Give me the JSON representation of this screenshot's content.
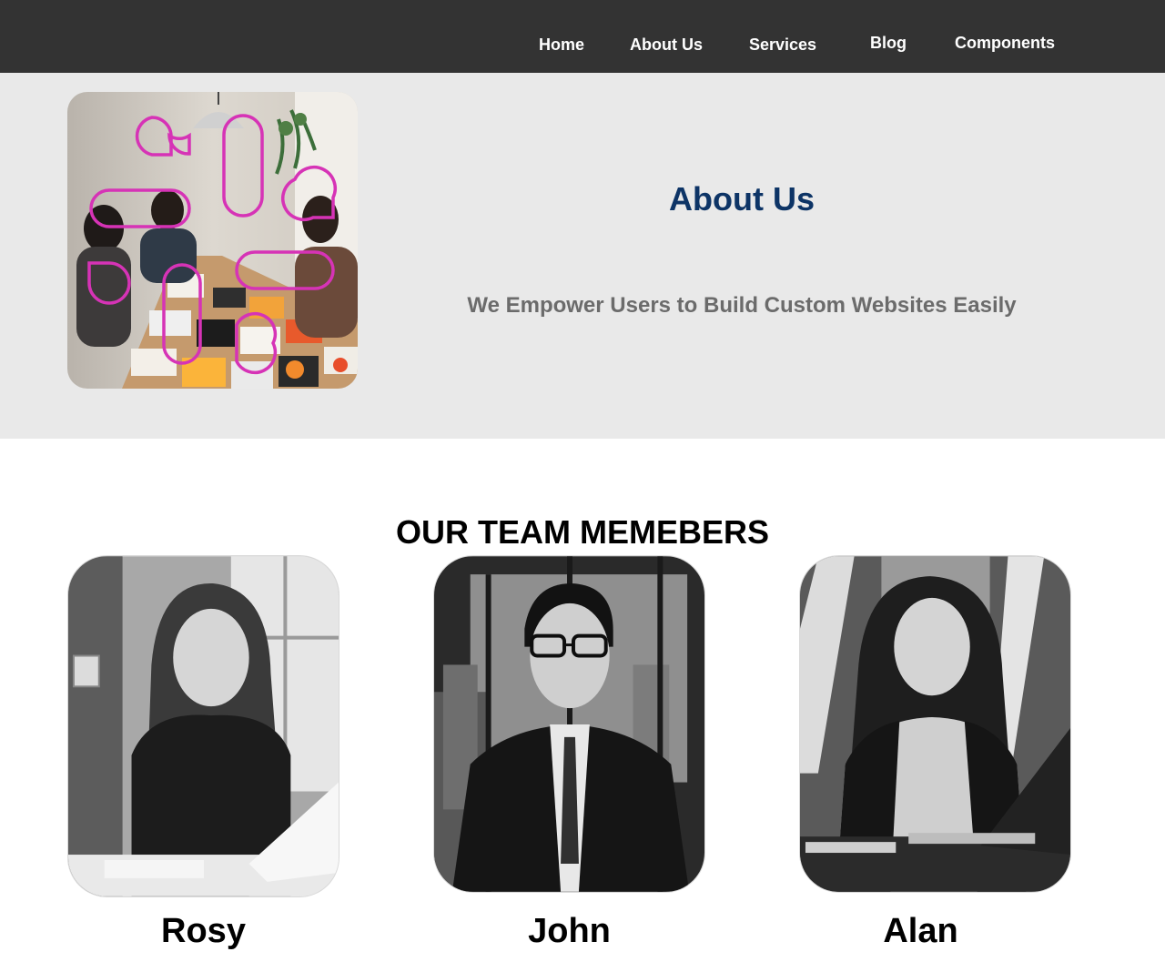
{
  "nav": {
    "items": [
      {
        "label": "Home"
      },
      {
        "label": "About Us"
      },
      {
        "label": "Services"
      },
      {
        "label": "Blog"
      },
      {
        "label": "Components"
      }
    ]
  },
  "hero": {
    "title": "About Us",
    "subtitle": "We Empower Users to Build Custom Websites Easily",
    "image_icon": "team-meeting-photo"
  },
  "team": {
    "title": "OUR TEAM MEMEBERS",
    "members": [
      {
        "name": "Rosy",
        "photo_icon": "woman-with-laptop-photo"
      },
      {
        "name": "John",
        "photo_icon": "man-in-suit-photo"
      },
      {
        "name": "Alan",
        "photo_icon": "woman-at-desk-photo"
      }
    ]
  },
  "colors": {
    "nav_bg": "#333333",
    "hero_bg": "#e9e9e9",
    "title_blue": "#0d3466",
    "subtitle_gray": "#6b6b6b",
    "accent_magenta": "#d633b6"
  }
}
